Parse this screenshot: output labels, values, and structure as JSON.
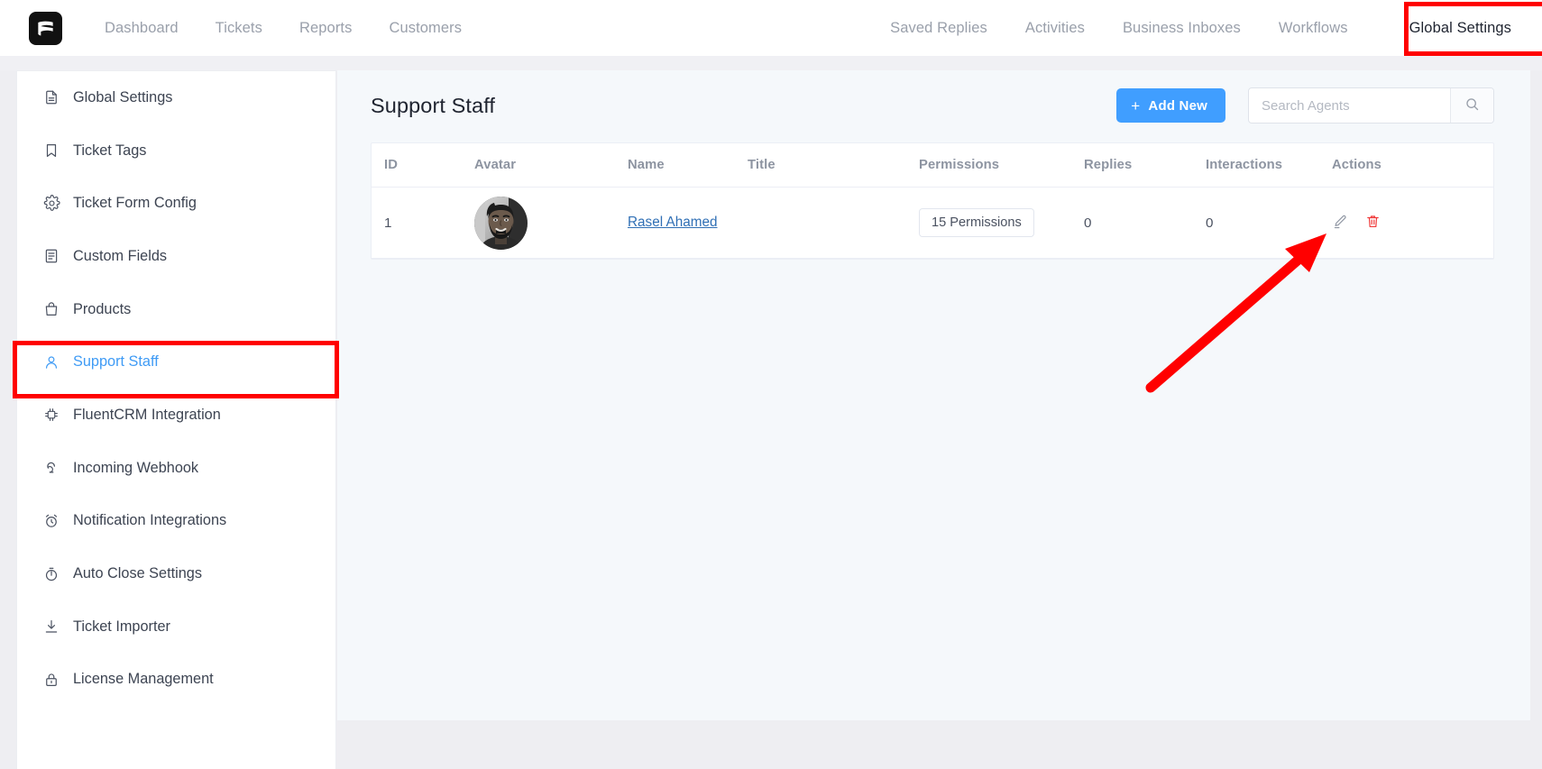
{
  "brand": {
    "logo_icon": "fluent-support-logo-icon",
    "accent_color": "#409eff",
    "danger_color": "#ff0000"
  },
  "topnav": {
    "left_items": [
      {
        "label": "Dashboard",
        "icon": "dashboard-icon"
      },
      {
        "label": "Tickets",
        "icon": "tickets-icon"
      },
      {
        "label": "Reports",
        "icon": "reports-icon"
      },
      {
        "label": "Customers",
        "icon": "customers-icon"
      }
    ],
    "right_items": [
      {
        "label": "Saved Replies"
      },
      {
        "label": "Activities"
      },
      {
        "label": "Business Inboxes"
      },
      {
        "label": "Workflows"
      }
    ],
    "active_item": {
      "label": "Global Settings"
    }
  },
  "sidebar": {
    "items": [
      {
        "label": "Global Settings",
        "icon": "document-icon",
        "active": false
      },
      {
        "label": "Ticket Tags",
        "icon": "bookmark-icon",
        "active": false
      },
      {
        "label": "Ticket Form Config",
        "icon": "gear-icon",
        "active": false
      },
      {
        "label": "Custom Fields",
        "icon": "list-doc-icon",
        "active": false
      },
      {
        "label": "Products",
        "icon": "bag-icon",
        "active": false
      },
      {
        "label": "Support Staff",
        "icon": "user-icon",
        "active": true
      },
      {
        "label": "FluentCRM Integration",
        "icon": "chip-icon",
        "active": false
      },
      {
        "label": "Incoming Webhook",
        "icon": "webhook-icon",
        "active": false
      },
      {
        "label": "Notification Integrations",
        "icon": "alarm-icon",
        "active": false
      },
      {
        "label": "Auto Close Settings",
        "icon": "stopwatch-icon",
        "active": false
      },
      {
        "label": "Ticket Importer",
        "icon": "download-icon",
        "active": false
      },
      {
        "label": "License Management",
        "icon": "lock-icon",
        "active": false
      }
    ]
  },
  "main": {
    "title": "Support Staff",
    "add_new_label": "Add New",
    "add_new_icon": "plus-icon",
    "search": {
      "placeholder": "Search Agents",
      "value": "",
      "button_icon": "search-icon"
    },
    "table": {
      "columns": [
        "ID",
        "Avatar",
        "Name",
        "Title",
        "Permissions",
        "Replies",
        "Interactions",
        "Actions"
      ],
      "rows": [
        {
          "id": "1",
          "avatar_alt": "Rasel Ahamed avatar",
          "name": "Rasel Ahamed",
          "title": "",
          "permissions": "15 Permissions",
          "replies": "0",
          "interactions": "0",
          "actions": [
            {
              "name": "edit-icon",
              "color": "#9aa0ab"
            },
            {
              "name": "delete-icon",
              "color": "#f03a3a"
            }
          ]
        }
      ]
    }
  },
  "annotations": {
    "boxes": [
      {
        "name": "global-settings-highlight",
        "color": "#ff0000"
      },
      {
        "name": "support-staff-highlight",
        "color": "#ff0000"
      }
    ],
    "arrow": {
      "name": "pointer-arrow",
      "color": "#ff0000",
      "points_to": "edit-icon"
    }
  }
}
